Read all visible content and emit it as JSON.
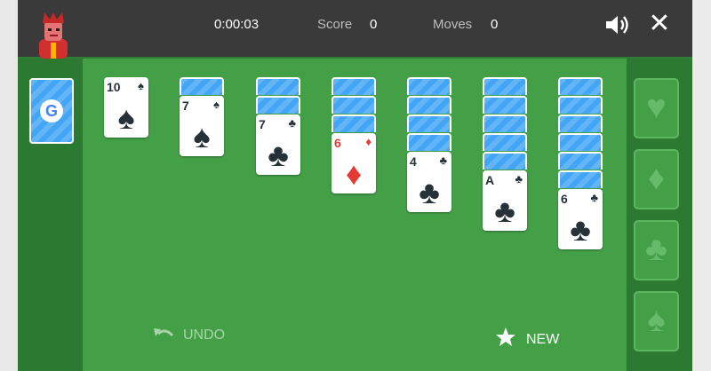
{
  "header": {
    "time": "0:00:03",
    "score_label": "Score",
    "score_value": "0",
    "moves_label": "Moves",
    "moves_value": "0",
    "close_glyph": "✕"
  },
  "stock": {
    "logo": "G"
  },
  "tableau": [
    {
      "face_rank": "10",
      "face_suit": "spade"
    },
    {
      "face_rank": "7",
      "face_suit": "spade"
    },
    {
      "face_rank": "7",
      "face_suit": "club"
    },
    {
      "face_rank": "6",
      "face_suit": "diamond"
    },
    {
      "face_rank": "4",
      "face_suit": "club"
    },
    {
      "face_rank": "A",
      "face_suit": "club"
    },
    {
      "face_rank": "6",
      "face_suit": "club"
    }
  ],
  "foundations": [
    {
      "suit": "heart",
      "glyph": "♥"
    },
    {
      "suit": "diamond",
      "glyph": "♦"
    },
    {
      "suit": "club",
      "glyph": "♣"
    },
    {
      "suit": "spade",
      "glyph": "♠"
    }
  ],
  "suit_glyphs": {
    "spade": "♠",
    "club": "♣",
    "diamond": "♦",
    "heart": "♥"
  },
  "buttons": {
    "undo": "UNDO",
    "new": "NEW"
  },
  "colors": {
    "felt": "#43a047",
    "side_felt": "#2c7a31",
    "header": "#3a3a3a",
    "card_back": "#42a5f5",
    "red_suit": "#e53935",
    "black_suit": "#263238"
  }
}
